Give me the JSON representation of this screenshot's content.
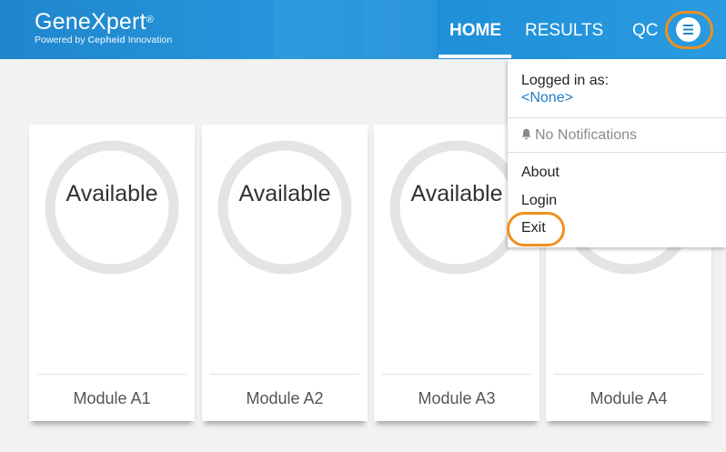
{
  "header": {
    "logo_main": "GeneXpert",
    "logo_reg": "®",
    "logo_sub_prefix": "Powered by ",
    "logo_sub_brand": "Cepheid",
    "logo_sub_suffix": " Innovation",
    "nav": {
      "home": "HOME",
      "results": "RESULTS",
      "qc": "QC"
    },
    "active_tab": "HOME",
    "menu_icon": "hamburger-menu-icon",
    "colors": {
      "bar": "#1f86cc",
      "highlight_ring": "#f0901c"
    }
  },
  "modules": [
    {
      "status": "Available",
      "name": "Module A1"
    },
    {
      "status": "Available",
      "name": "Module A2"
    },
    {
      "status": "Available",
      "name": "Module A3"
    },
    {
      "status": "",
      "name": "Module A4"
    }
  ],
  "dropdown": {
    "logged_in_label": "Logged in as:",
    "user": "<None>",
    "notifications": "No Notifications",
    "notification_icon": "bell-icon",
    "items": {
      "about": "About",
      "login": "Login",
      "exit": "Exit"
    }
  }
}
